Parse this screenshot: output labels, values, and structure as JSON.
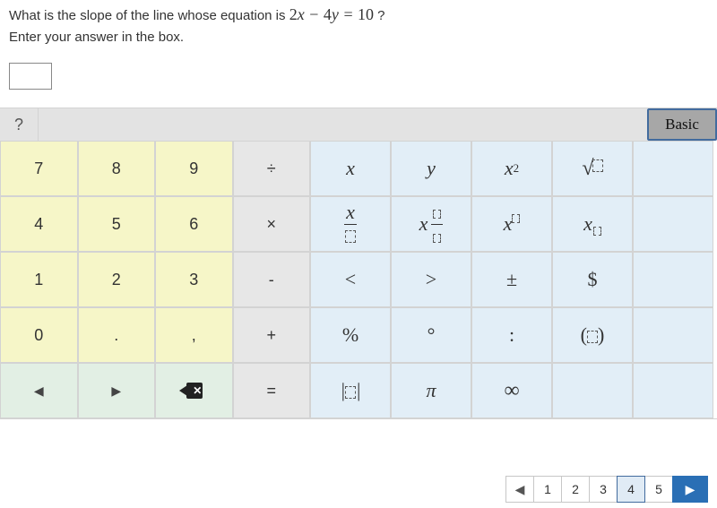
{
  "question": {
    "prefix": "What is the slope of the line whose equation is ",
    "equation": "2x − 4y = 10",
    "suffix": " ?",
    "instruction": "Enter your answer in the box.",
    "answer_value": ""
  },
  "header": {
    "help": "?",
    "mode": "Basic"
  },
  "keys": {
    "n7": "7",
    "n8": "8",
    "n9": "9",
    "n4": "4",
    "n5": "5",
    "n6": "6",
    "n1": "1",
    "n2": "2",
    "n3": "3",
    "n0": "0",
    "dot": ".",
    "comma": ",",
    "div": "÷",
    "mul": "×",
    "sub": "-",
    "add": "+",
    "eq": "=",
    "x": "x",
    "y": "y",
    "x2_base": "x",
    "x2_exp": "2",
    "frac_top": "x",
    "lt": "<",
    "gt": ">",
    "pm": "±",
    "dollar": "$",
    "pct": "%",
    "deg": "°",
    "colon": ":",
    "pi": "π",
    "inf": "∞",
    "left": "◀",
    "right": "▶",
    "sqrt": "√",
    "paren_l": "(",
    "paren_r": ")",
    "abs_bar": "|"
  },
  "paginate": {
    "left": "◀",
    "right": "▶",
    "pages": [
      "1",
      "2",
      "3",
      "4",
      "5"
    ],
    "selected": 3
  }
}
